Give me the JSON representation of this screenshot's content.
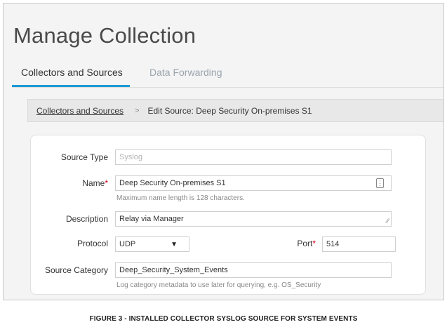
{
  "header": {
    "title": "Manage Collection"
  },
  "tabs": [
    {
      "label": "Collectors and Sources",
      "active": true
    },
    {
      "label": "Data Forwarding",
      "active": false
    }
  ],
  "breadcrumb": {
    "link": "Collectors and Sources",
    "separator": ">",
    "current": "Edit Source: Deep Security On-premises S1"
  },
  "form": {
    "source_type": {
      "label": "Source Type",
      "placeholder": "Syslog"
    },
    "name": {
      "label": "Name",
      "required_mark": "*",
      "value": "Deep Security  On-premises S1",
      "hint": "Maximum name length is 128 characters.",
      "icon": "id-card-icon"
    },
    "description": {
      "label": "Description",
      "value": "Relay via Manager",
      "icon": "resize-handle-icon"
    },
    "protocol": {
      "label": "Protocol",
      "value": "UDP",
      "caret": "▼"
    },
    "port": {
      "label": "Port",
      "required_mark": "*",
      "value": "514"
    },
    "source_category": {
      "label": "Source Category",
      "value": "Deep_Security_System_Events",
      "hint": "Log category metadata to use later for querying, e.g. OS_Security"
    }
  },
  "caption": "FIGURE 3 - INSTALLED COLLECTOR SYSLOG SOURCE FOR SYSTEM EVENTS",
  "colors": {
    "accent": "#1b9ad6",
    "required": "#d0021b",
    "background": "#f4f4f4"
  }
}
